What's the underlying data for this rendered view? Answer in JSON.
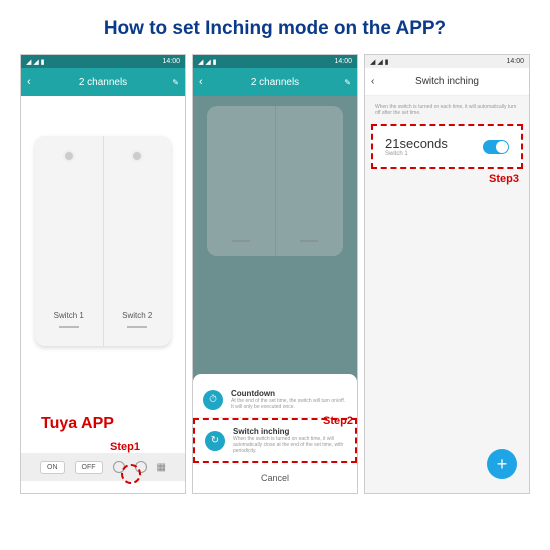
{
  "title": "How to set Inching mode  on the APP?",
  "status": {
    "time": "14:00",
    "icons": "◢ ◢ ▮"
  },
  "phone1": {
    "header": "2 channels",
    "switch1": "Switch 1",
    "switch2": "Switch 2",
    "appLabel": "Tuya APP",
    "on": "ON",
    "off": "OFF",
    "stepLabel": "Step1"
  },
  "phone2": {
    "header": "2 channels",
    "option1": {
      "title": "Countdown",
      "desc": "At the end of the set time, the switch will turn on/off. It will only be executed once."
    },
    "option2": {
      "title": "Switch inching",
      "desc": "When the switch is turned on each time, it will automatically close at the end of the set time, with periodicity."
    },
    "cancel": "Cancel",
    "stepLabel": "Step2"
  },
  "phone3": {
    "header": "Switch inching",
    "hint": "When the switch is turned on each time, it will automatically turn off after the set time.",
    "value": "21seconds",
    "sub": "Switch 1",
    "stepLabel": "Step3",
    "fab": "+"
  }
}
